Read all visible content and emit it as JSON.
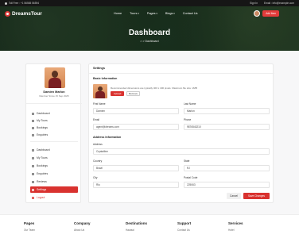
{
  "topbar": {
    "phone": "Toll Free : +1 56565 56594",
    "sign": "Sign In",
    "email": "Email : info@example.com"
  },
  "header": {
    "logo_text": "DreamsTour",
    "menu": [
      "Home",
      "Tours",
      "Pages",
      "Blogs",
      "Contact Us"
    ],
    "add_button": "Add Item"
  },
  "hero": {
    "title": "Dashboard",
    "breadcrumb": "⌂ > Dashboard"
  },
  "sidebar": {
    "name": "Damien Marlon",
    "since": "Member Since 15 Sep 2025",
    "group1": [
      "Dashboard",
      "My Tours",
      "Bookings",
      "Enquiries"
    ],
    "group2": [
      "Dashboard",
      "My Tours",
      "Bookings",
      "Enquiries",
      "Reviews",
      "Settings"
    ],
    "logout": "Logout"
  },
  "main": {
    "title": "Settings",
    "basic_info": "Basic Information",
    "hint": "Recommended dimensions are typically 400 x 400 pixels. Maximum file size: 2MB",
    "upload": "Upload",
    "remove": "Remove",
    "first_name_label": "First Name",
    "first_name": "Damien",
    "last_name_label": "Last Name",
    "last_name": "Marlon",
    "email_label": "Email",
    "email": "agent@dreams.com",
    "phone_label": "Phone",
    "phone": "9876543210",
    "address_info": "Address Information",
    "address_label": "Address",
    "address": "Crystalline",
    "country_label": "Country",
    "country": "Brazil",
    "state_label": "State",
    "state": "RJ",
    "city_label": "City",
    "city": "Rio",
    "postal_label": "Postal Code",
    "postal": "225063",
    "cancel": "Cancel",
    "save": "Save Changes"
  },
  "footer": {
    "cols": [
      {
        "h": "Pages",
        "l": "Our Team"
      },
      {
        "h": "Company",
        "l": "About Us"
      },
      {
        "h": "Destinations",
        "l": "Hawaai"
      },
      {
        "h": "Support",
        "l": "Contact Us"
      },
      {
        "h": "Services",
        "l": "Hotel"
      }
    ]
  }
}
